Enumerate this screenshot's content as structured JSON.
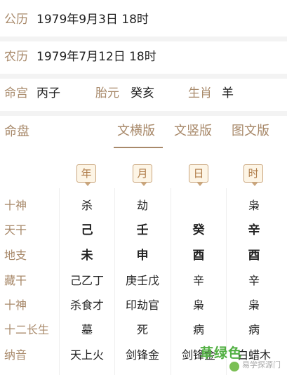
{
  "solar": {
    "label": "公历",
    "value": "1979年9月3日 18时"
  },
  "lunar": {
    "label": "农历",
    "value": "1979年7月12日 18时"
  },
  "info": {
    "minggong_label": "命宫",
    "minggong_value": "丙子",
    "taiyuan_label": "胎元",
    "taiyuan_value": "癸亥",
    "shengxiao_label": "生肖",
    "shengxiao_value": "羊"
  },
  "chart": {
    "title": "命盘",
    "tabs": [
      {
        "label": "文横版",
        "active": true
      },
      {
        "label": "文竖版",
        "active": false
      },
      {
        "label": "图文版",
        "active": false
      }
    ]
  },
  "columns": [
    "年",
    "月",
    "日",
    "时"
  ],
  "rows": [
    {
      "label": "十神",
      "cells": [
        "杀",
        "劫",
        "",
        "枭"
      ]
    },
    {
      "label": "天干",
      "cells": [
        "己",
        "壬",
        "癸",
        "辛"
      ]
    },
    {
      "label": "地支",
      "cells": [
        "未",
        "申",
        "酉",
        "酉"
      ]
    },
    {
      "label": "藏干",
      "cells": [
        "己乙丁",
        "庚壬戊",
        "辛",
        "辛"
      ]
    },
    {
      "label": "十神",
      "cells": [
        "杀食才",
        "印劫官",
        "枭",
        "枭"
      ]
    },
    {
      "label": "十二长生",
      "cells": [
        "墓",
        "死",
        "病",
        "病"
      ]
    },
    {
      "label": "纳音",
      "cells": [
        "天上火",
        "剑锋金",
        "剑锋金",
        "白蜡木"
      ]
    }
  ],
  "watermark": {
    "green": "草绿色",
    "small": "易学探源门"
  },
  "colors": {
    "label": "#a8896a",
    "text": "#222222",
    "accent_box": "#fdf5e6",
    "green": "#52b043"
  }
}
